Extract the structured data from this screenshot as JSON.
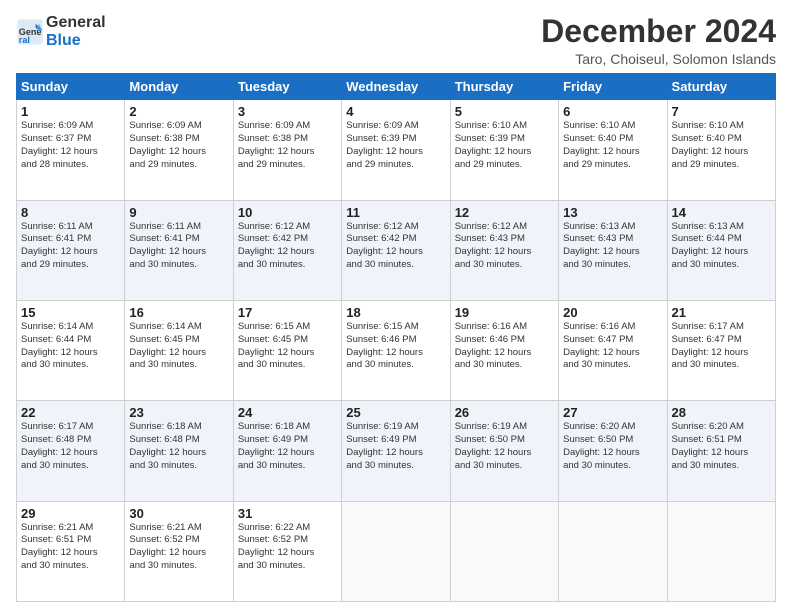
{
  "logo": {
    "text_general": "General",
    "text_blue": "Blue"
  },
  "title": "December 2024",
  "subtitle": "Taro, Choiseul, Solomon Islands",
  "weekdays": [
    "Sunday",
    "Monday",
    "Tuesday",
    "Wednesday",
    "Thursday",
    "Friday",
    "Saturday"
  ],
  "weeks": [
    [
      {
        "day": "1",
        "info": "Sunrise: 6:09 AM\nSunset: 6:37 PM\nDaylight: 12 hours\nand 28 minutes."
      },
      {
        "day": "2",
        "info": "Sunrise: 6:09 AM\nSunset: 6:38 PM\nDaylight: 12 hours\nand 29 minutes."
      },
      {
        "day": "3",
        "info": "Sunrise: 6:09 AM\nSunset: 6:38 PM\nDaylight: 12 hours\nand 29 minutes."
      },
      {
        "day": "4",
        "info": "Sunrise: 6:09 AM\nSunset: 6:39 PM\nDaylight: 12 hours\nand 29 minutes."
      },
      {
        "day": "5",
        "info": "Sunrise: 6:10 AM\nSunset: 6:39 PM\nDaylight: 12 hours\nand 29 minutes."
      },
      {
        "day": "6",
        "info": "Sunrise: 6:10 AM\nSunset: 6:40 PM\nDaylight: 12 hours\nand 29 minutes."
      },
      {
        "day": "7",
        "info": "Sunrise: 6:10 AM\nSunset: 6:40 PM\nDaylight: 12 hours\nand 29 minutes."
      }
    ],
    [
      {
        "day": "8",
        "info": "Sunrise: 6:11 AM\nSunset: 6:41 PM\nDaylight: 12 hours\nand 29 minutes."
      },
      {
        "day": "9",
        "info": "Sunrise: 6:11 AM\nSunset: 6:41 PM\nDaylight: 12 hours\nand 30 minutes."
      },
      {
        "day": "10",
        "info": "Sunrise: 6:12 AM\nSunset: 6:42 PM\nDaylight: 12 hours\nand 30 minutes."
      },
      {
        "day": "11",
        "info": "Sunrise: 6:12 AM\nSunset: 6:42 PM\nDaylight: 12 hours\nand 30 minutes."
      },
      {
        "day": "12",
        "info": "Sunrise: 6:12 AM\nSunset: 6:43 PM\nDaylight: 12 hours\nand 30 minutes."
      },
      {
        "day": "13",
        "info": "Sunrise: 6:13 AM\nSunset: 6:43 PM\nDaylight: 12 hours\nand 30 minutes."
      },
      {
        "day": "14",
        "info": "Sunrise: 6:13 AM\nSunset: 6:44 PM\nDaylight: 12 hours\nand 30 minutes."
      }
    ],
    [
      {
        "day": "15",
        "info": "Sunrise: 6:14 AM\nSunset: 6:44 PM\nDaylight: 12 hours\nand 30 minutes."
      },
      {
        "day": "16",
        "info": "Sunrise: 6:14 AM\nSunset: 6:45 PM\nDaylight: 12 hours\nand 30 minutes."
      },
      {
        "day": "17",
        "info": "Sunrise: 6:15 AM\nSunset: 6:45 PM\nDaylight: 12 hours\nand 30 minutes."
      },
      {
        "day": "18",
        "info": "Sunrise: 6:15 AM\nSunset: 6:46 PM\nDaylight: 12 hours\nand 30 minutes."
      },
      {
        "day": "19",
        "info": "Sunrise: 6:16 AM\nSunset: 6:46 PM\nDaylight: 12 hours\nand 30 minutes."
      },
      {
        "day": "20",
        "info": "Sunrise: 6:16 AM\nSunset: 6:47 PM\nDaylight: 12 hours\nand 30 minutes."
      },
      {
        "day": "21",
        "info": "Sunrise: 6:17 AM\nSunset: 6:47 PM\nDaylight: 12 hours\nand 30 minutes."
      }
    ],
    [
      {
        "day": "22",
        "info": "Sunrise: 6:17 AM\nSunset: 6:48 PM\nDaylight: 12 hours\nand 30 minutes."
      },
      {
        "day": "23",
        "info": "Sunrise: 6:18 AM\nSunset: 6:48 PM\nDaylight: 12 hours\nand 30 minutes."
      },
      {
        "day": "24",
        "info": "Sunrise: 6:18 AM\nSunset: 6:49 PM\nDaylight: 12 hours\nand 30 minutes."
      },
      {
        "day": "25",
        "info": "Sunrise: 6:19 AM\nSunset: 6:49 PM\nDaylight: 12 hours\nand 30 minutes."
      },
      {
        "day": "26",
        "info": "Sunrise: 6:19 AM\nSunset: 6:50 PM\nDaylight: 12 hours\nand 30 minutes."
      },
      {
        "day": "27",
        "info": "Sunrise: 6:20 AM\nSunset: 6:50 PM\nDaylight: 12 hours\nand 30 minutes."
      },
      {
        "day": "28",
        "info": "Sunrise: 6:20 AM\nSunset: 6:51 PM\nDaylight: 12 hours\nand 30 minutes."
      }
    ],
    [
      {
        "day": "29",
        "info": "Sunrise: 6:21 AM\nSunset: 6:51 PM\nDaylight: 12 hours\nand 30 minutes."
      },
      {
        "day": "30",
        "info": "Sunrise: 6:21 AM\nSunset: 6:52 PM\nDaylight: 12 hours\nand 30 minutes."
      },
      {
        "day": "31",
        "info": "Sunrise: 6:22 AM\nSunset: 6:52 PM\nDaylight: 12 hours\nand 30 minutes."
      },
      {
        "day": "",
        "info": ""
      },
      {
        "day": "",
        "info": ""
      },
      {
        "day": "",
        "info": ""
      },
      {
        "day": "",
        "info": ""
      }
    ]
  ]
}
